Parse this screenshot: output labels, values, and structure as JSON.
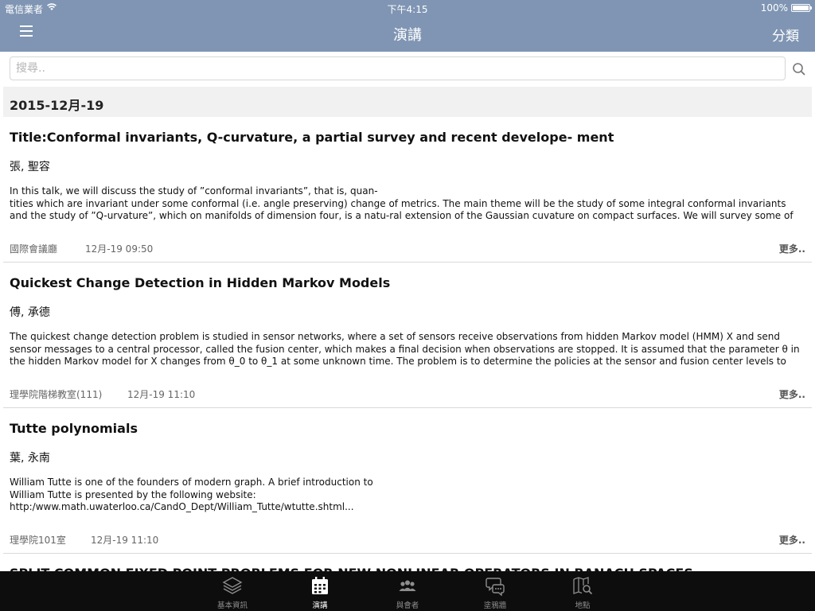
{
  "status_bar": {
    "carrier": "電信業者",
    "time": "下午4:15",
    "battery": "100%"
  },
  "nav": {
    "title": "演講",
    "right_button": "分類",
    "menu_icon": "hamburger-menu-icon"
  },
  "search": {
    "placeholder": "搜尋..",
    "value": "",
    "icon": "search-icon"
  },
  "date_header": "2015-12月-19",
  "talks": [
    {
      "title": "Title:Conformal invariants, Q-curvature, a partial survey and recent develope- ment",
      "speaker": "張, 聖容",
      "abstract": "In this talk, we will discuss the study of ”conformal invariants”, that is, quan-\ntities which are invariant under some conformal (i.e. angle preserving) change of metrics. The main theme will be the study of some integral conformal invariants and the study of ”Q-urvature”, which on manifolds of dimension four, is a natu-ral extension of the Gaussian cuvature on compact surfaces. We will survey some of the...",
      "venue": "國際會議廳",
      "datetime": "12月-19 09:50",
      "more": "更多.."
    },
    {
      "title": "Quickest Change Detection in Hidden Markov Models",
      "speaker": "傅, 承德",
      "abstract": "The quickest change detection problem is studied in sensor networks, where a set of sensors receive observations from hidden Markov model (HMM) X and send sensor messages to a central processor, called the fusion center, which makes a final decision when observations are stopped. It is assumed that the parameter θ in the hidden Markov model for X changes from θ_0 to θ_1 at some unknown time. The problem is to determine the policies at the sensor and fusion center levels to joi...",
      "venue": "理學院階梯教室(111)",
      "datetime": "12月-19 11:10",
      "more": "更多.."
    },
    {
      "title": "Tutte polynomials",
      "speaker": "葉, 永南",
      "abstract": "William Tutte is one of the founders of modern graph. A brief introduction to\nWilliam Tutte is presented by the following website:\nhttp:/www.math.uwaterloo.ca/CandO_Dept/William_Tutte/wtutte.shtml...",
      "venue": "理學院101室",
      "datetime": "12月-19 11:10",
      "more": "更多.."
    }
  ],
  "peek_title": "SPLIT COMMON FIXED POINT PROBLEMS FOR NEW NONLINEAR OPERATORS IN BANACH SPACES",
  "tabs": [
    {
      "label": "基本資訊",
      "icon": "layers-icon",
      "active": false
    },
    {
      "label": "演講",
      "icon": "calendar-icon",
      "active": true
    },
    {
      "label": "與會者",
      "icon": "people-icon",
      "active": false
    },
    {
      "label": "塗鴉牆",
      "icon": "chat-bubbles-icon",
      "active": false
    },
    {
      "label": "地點",
      "icon": "map-search-icon",
      "active": false
    }
  ],
  "colors": {
    "nav_bar": "#7f95b3",
    "tab_bar": "#0d0d0d",
    "date_header_bg": "#f1f1f1"
  }
}
